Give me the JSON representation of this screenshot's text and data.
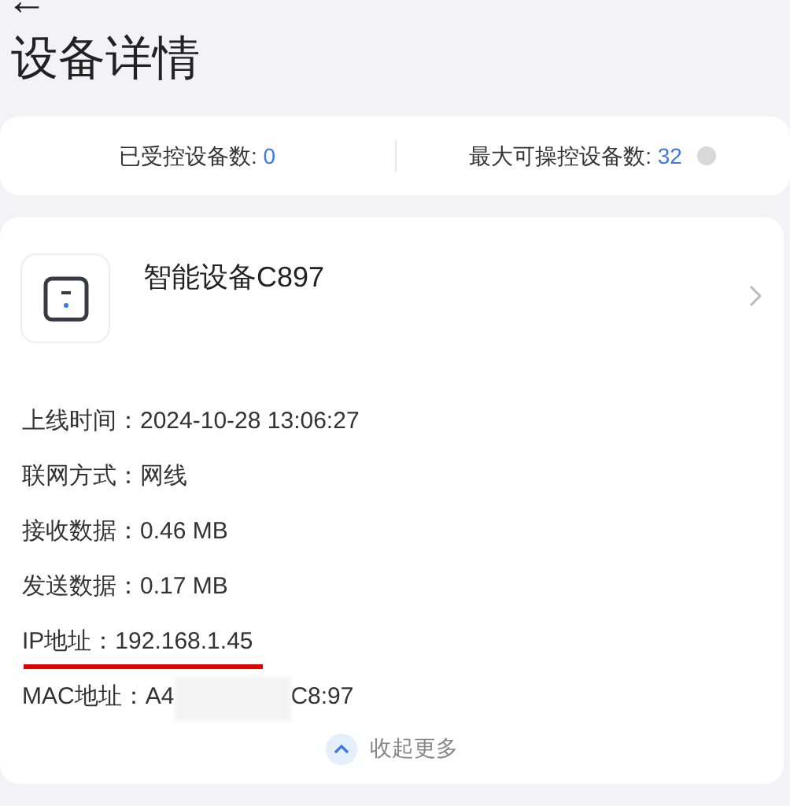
{
  "header": {
    "back": "←",
    "title": "设备详情"
  },
  "stats": [
    {
      "label": "已受控设备数: ",
      "value": "0",
      "info": false
    },
    {
      "label": "最大可操控设备数: ",
      "value": "32",
      "info": true
    }
  ],
  "device": {
    "name": "智能设备C897",
    "details": [
      {
        "kind": "text",
        "label": "上线时间：",
        "value": "2024-10-28 13:06:27",
        "underlined": false
      },
      {
        "kind": "text",
        "label": "联网方式：",
        "value": "网线",
        "underlined": false
      },
      {
        "kind": "text",
        "label": "接收数据：",
        "value": "0.46 MB",
        "underlined": false
      },
      {
        "kind": "text",
        "label": "发送数据：",
        "value": "0.17 MB",
        "underlined": false
      },
      {
        "kind": "text",
        "label": "IP地址：",
        "value": "192.168.1.45",
        "underlined": true
      },
      {
        "kind": "redacted",
        "label": "MAC地址：",
        "value": "A4",
        "value_after": "C8:97",
        "underlined": false
      }
    ],
    "collapse": "收起更多"
  }
}
